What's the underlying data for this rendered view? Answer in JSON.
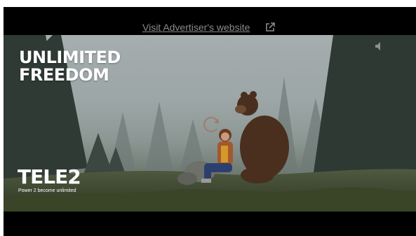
{
  "ad": {
    "visit_link": "Visit Advertiser's website",
    "headline_line1": "UNLIMITED",
    "headline_line2": "FREEDOM",
    "brand_name": "TELE2",
    "brand_tagline": "Power 2 become unlimited"
  },
  "icons": {
    "external_link": "external-link-icon",
    "mute": "speaker-icon",
    "replay": "replay-icon"
  },
  "colors": {
    "player_background": "#000000",
    "link_text": "#8a8a8a",
    "overlay_text": "#ffffff"
  }
}
